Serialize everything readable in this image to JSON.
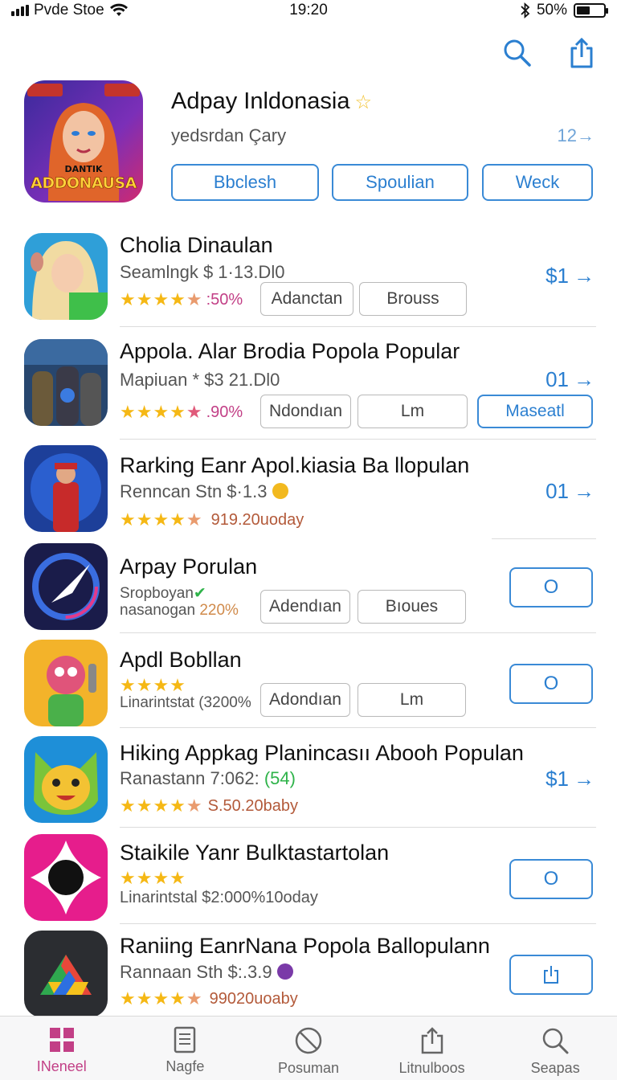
{
  "status": {
    "carrier": "Pvde Stoe",
    "time": "19:20",
    "battery": "50%",
    "battery_level": 0.5
  },
  "nav": {
    "search_icon": "search-icon",
    "share_icon": "share-icon"
  },
  "featured": {
    "art_line1": "DANTIK",
    "art_line2": "ADDONAUSA",
    "title": "Adpay Inldonasia",
    "subtitle": "yedsrdan Çary",
    "count": "12",
    "buttons": [
      "Bbclesh",
      "Spoulian",
      "Weck"
    ]
  },
  "apps": [
    {
      "name": "Cholia Dinaulan",
      "sub": "Seamlngk $ 1·13.Dl0",
      "rating": ":50%",
      "chips": [
        "Adanctan",
        "Brouss"
      ],
      "price": "$1"
    },
    {
      "name": "Appola. Alar Brodia Popola Popular",
      "sub": "Mapiuan * $3 21.Dl0",
      "rating": ".90%",
      "chips": [
        "Ndondıan",
        "Lm"
      ],
      "button": "Maseatl",
      "price": "01"
    },
    {
      "name": "Rarking Eanr Apol.kiasia Ba llopulan",
      "sub": "Renncan Stn $·1.3",
      "rating": "919.20uoday",
      "price": "01"
    },
    {
      "name": "Arpay Porulan",
      "sub": "Sropboyan",
      "sub2": "nasanogan",
      "rating": "220%",
      "chips": [
        "Adendıan",
        "Bıoues"
      ],
      "button": "O"
    },
    {
      "name": "Apdl Bobllan",
      "sub": "Linarintstat",
      "rating": "(3200%",
      "chips": [
        "Adondıan",
        "Lm"
      ],
      "button": "O"
    },
    {
      "name": "Hiking Appkag Planincasıı Abooh Populan",
      "sub": "Ranastann 7:062:",
      "sub_extra": "(54)",
      "rating": "S.50.20baby",
      "price": "$1"
    },
    {
      "name": "Staikile Yanr Bulktastartolan",
      "sub": "Linarintstal",
      "rating": "$2:000%10oday",
      "button": "O"
    },
    {
      "name": "Raniing EanrNana Popola Ballopulann",
      "sub": "Rannaan Sth $:.3.9",
      "rating": "99020uoaby"
    }
  ],
  "tabs": [
    "INeneel",
    "Nagfe",
    "Posuman",
    "Litnulboos",
    "Seapas"
  ]
}
